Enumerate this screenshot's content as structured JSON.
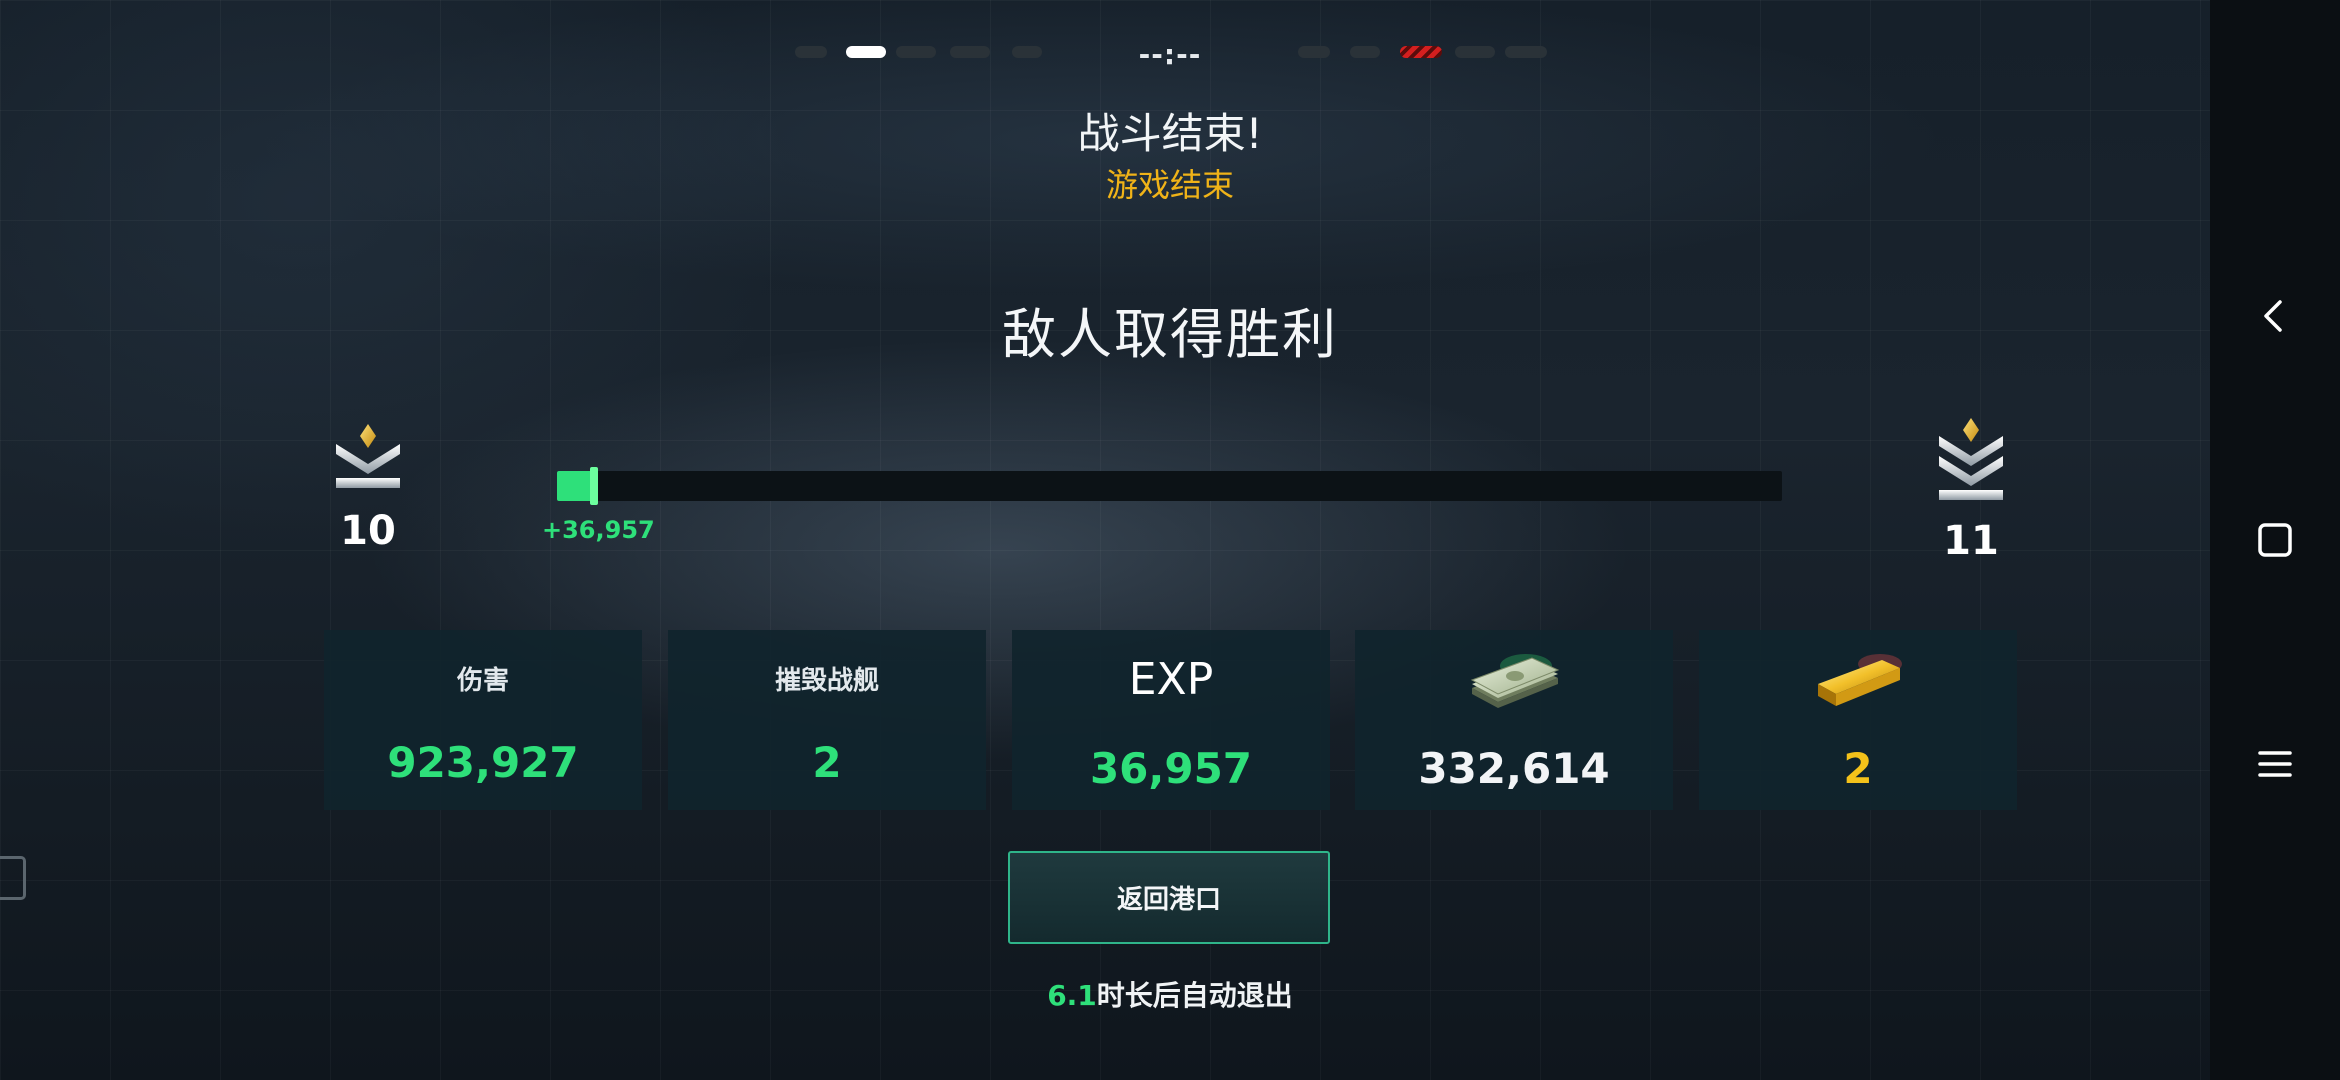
{
  "timer": {
    "text": "--:--"
  },
  "header": {
    "battle_over": "战斗结束!",
    "game_over": "游戏结束"
  },
  "result": {
    "text": "敌人取得胜利"
  },
  "rank": {
    "current_level": "10",
    "next_level": "11",
    "progress_fraction": 0.03,
    "gain_label": "+36,957"
  },
  "stats": [
    {
      "label": "伤害",
      "value": "923,927"
    },
    {
      "label": "摧毁战舰",
      "value": "2"
    },
    {
      "label": "EXP",
      "value": "36,957"
    },
    {
      "icon": "cash-stack-icon",
      "value": "332,614"
    },
    {
      "icon": "gold-bar-icon",
      "value": "2"
    }
  ],
  "actions": {
    "return_label": "返回港口"
  },
  "auto_exit": {
    "seconds": "6.1",
    "suffix": "时长后自动退出"
  },
  "colors": {
    "accent_green": "#2ee07a",
    "gold": "#f4c21a",
    "enemy_red": "#d41f1f"
  }
}
